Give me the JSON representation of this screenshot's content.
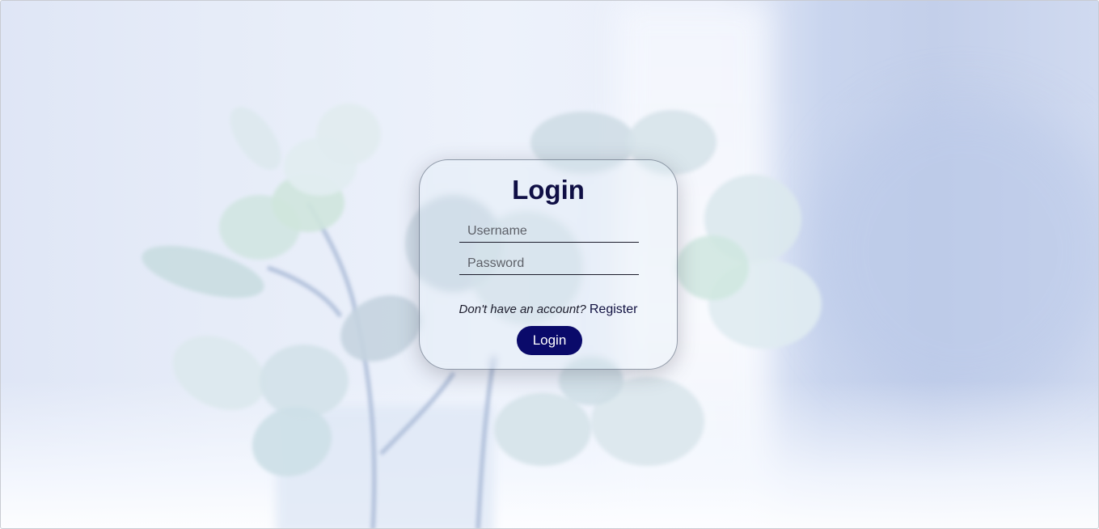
{
  "login_form": {
    "title": "Login",
    "username_placeholder": "Username",
    "username_value": "",
    "password_placeholder": "Password",
    "password_value": "",
    "register_prompt": "Don't have an account?",
    "register_link": "Register",
    "submit_label": "Login"
  },
  "colors": {
    "accent": "#0a0a6a",
    "title": "#0f0f45"
  }
}
